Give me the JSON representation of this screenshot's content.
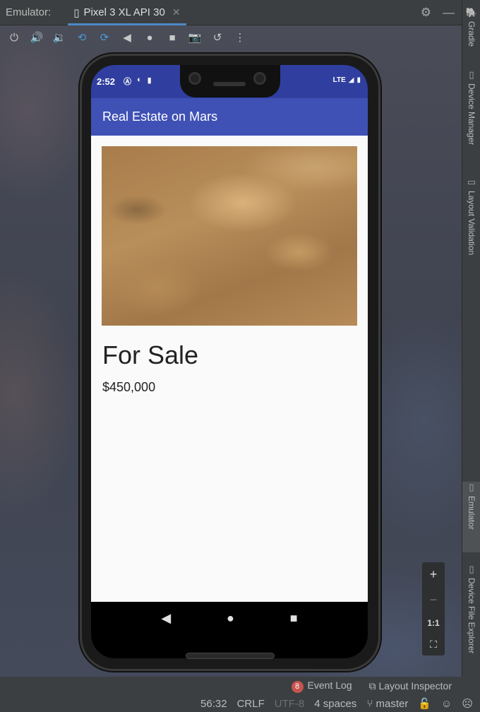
{
  "ide": {
    "emulator_label": "Emulator:",
    "device_tab": "Pixel 3 XL API 30",
    "tab_close": "✕"
  },
  "toolbar": {
    "icons": [
      "power-icon",
      "volume-up-icon",
      "volume-down-icon",
      "rotate-left-icon",
      "rotate-right-icon",
      "back-icon",
      "home-icon",
      "overview-icon",
      "screenshot-icon",
      "snapshot-icon",
      "more-icon"
    ]
  },
  "sidebar": {
    "items": [
      {
        "label": "Gradle"
      },
      {
        "label": "Device Manager"
      },
      {
        "label": "Layout Validation"
      },
      {
        "label": "Emulator"
      },
      {
        "label": "Device File Explorer"
      }
    ]
  },
  "device": {
    "status_time": "2:52",
    "status_network": "LTE",
    "app_title": "Real Estate on Mars",
    "listing_title": "For Sale",
    "listing_price": "$450,000"
  },
  "zoom": {
    "zoom_in": "+",
    "zoom_out": "−",
    "actual_size": "1:1"
  },
  "tool_windows": {
    "event_log_count": "8",
    "event_log": "Event Log",
    "layout_inspector": "Layout Inspector"
  },
  "statusbar": {
    "position": "56:32",
    "line_sep": "CRLF",
    "encoding": "UTF-8",
    "indent": "4 spaces",
    "branch": "master"
  }
}
